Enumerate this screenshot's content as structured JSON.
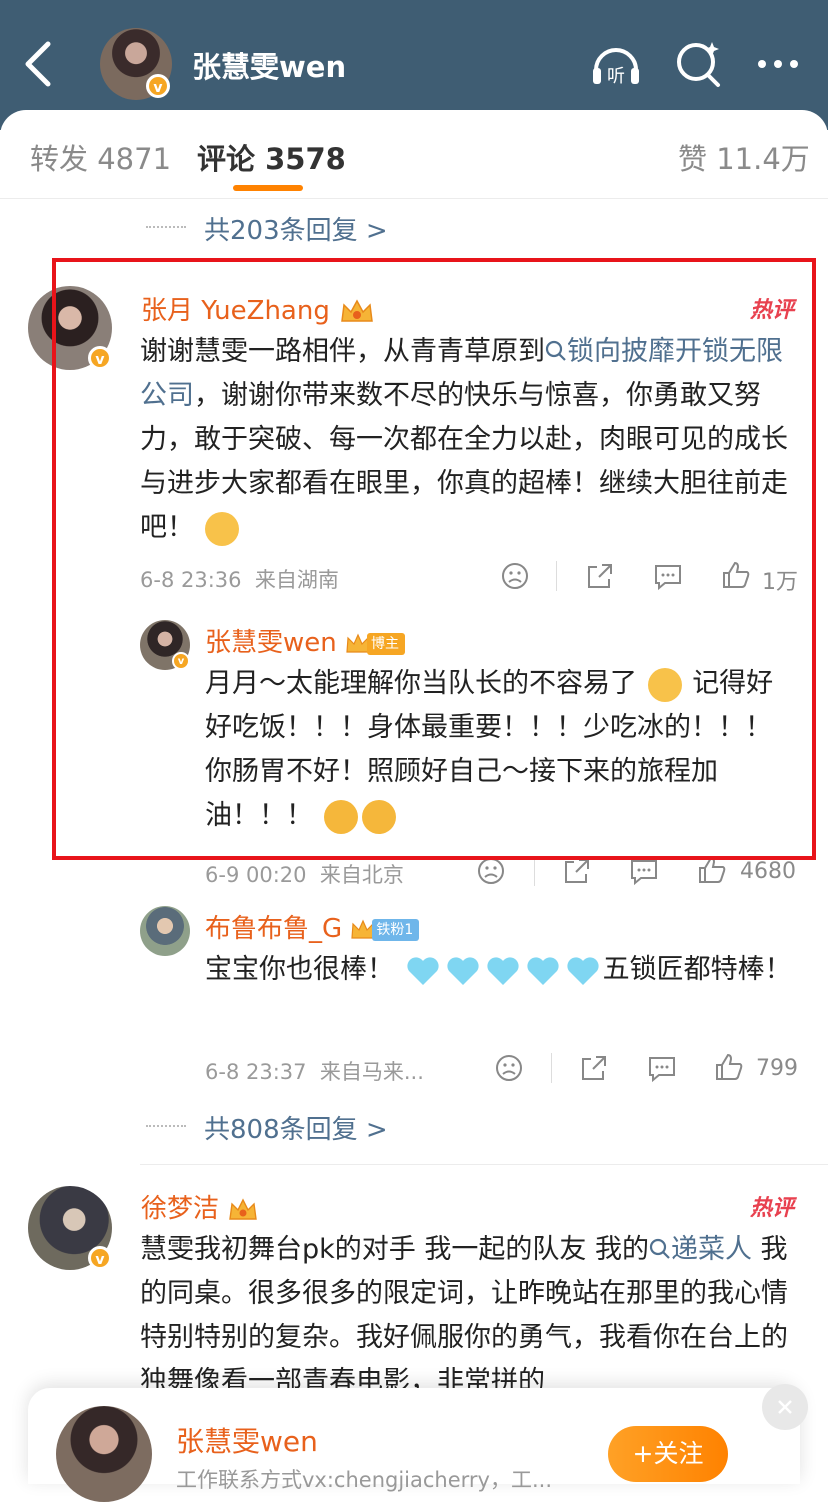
{
  "header": {
    "title": "张慧雯wen",
    "listen_label": "听",
    "icons": [
      "back-icon",
      "listen-icon",
      "search-icon",
      "more-icon"
    ]
  },
  "tabs": {
    "repost": "转发 4871",
    "comment": "评论 3578",
    "like": "赞 11.4万"
  },
  "replies_more_top": "共203条回复 >",
  "comments": [
    {
      "name": "张月 YueZhang",
      "hot_badge": "热评",
      "text_before_link": "谢谢慧雯一路相伴，从青青草原到",
      "link": "锁向披靡开锁无限公司",
      "text_after_link": "，谢谢你带来数不尽的快乐与惊喜，你勇敢又努力，敢于突破、每一次都在全力以赴，肉眼可见的成长与进步大家都看在眼里，你真的超棒！继续大胆往前走吧！",
      "time": "6-8 23:36",
      "location": "来自湖南",
      "likes": "1万",
      "replies": [
        {
          "name": "张慧雯wen",
          "tag": "博主",
          "text_a": "月月～太能理解你当队长的不容易了",
          "text_b": "记得好好吃饭！！！身体最重要！！！少吃冰的！！！你肠胃不好！照顾好自己～接下来的旅程加油！！！",
          "time": "6-9 00:20",
          "location": "来自北京",
          "likes": "4680"
        },
        {
          "name": "布鲁布鲁_G",
          "tag": "铁粉1",
          "text_a": "宝宝你也很棒！",
          "text_b": "五锁匠都特棒！",
          "time": "6-8 23:37",
          "location": "来自马来...",
          "likes": "799"
        }
      ],
      "more_replies": "共808条回复 >"
    },
    {
      "name": "徐梦洁",
      "hot_badge": "热评",
      "text_before_link": "慧雯我初舞台pk的对手 我一起的队友 我的",
      "link": "递菜人",
      "text_after_link": " 我的同桌。很多很多的限定词，让昨晚站在那里的我心情特别特别的复杂。我好佩服你的勇气，我看你在台上的独舞像看一部青春电影，非常拼的"
    }
  ],
  "footer": {
    "name": "张慧雯wen",
    "desc": "工作联系方式vx:chengjiacherry，工...",
    "follow_label": "+关注"
  }
}
